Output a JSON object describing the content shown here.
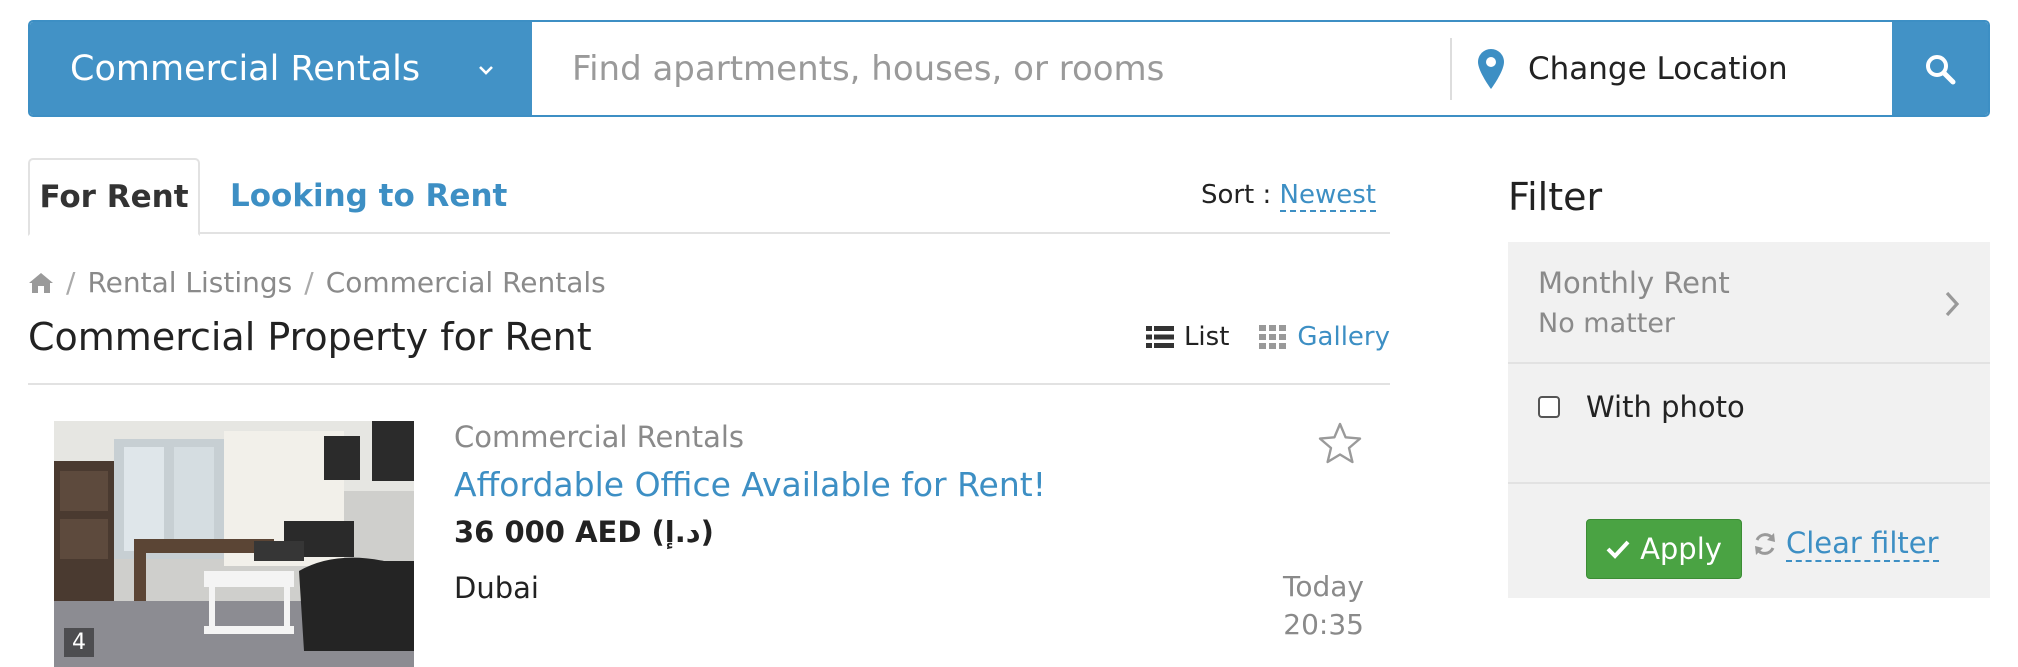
{
  "search": {
    "category": "Commercial Rentals",
    "placeholder": "Find apartments, houses, or rooms",
    "value": "",
    "location_label": "Change Location"
  },
  "tabs": [
    {
      "label": "For Rent",
      "active": true
    },
    {
      "label": "Looking to Rent",
      "active": false
    }
  ],
  "sort": {
    "label": "Sort :",
    "value": "Newest"
  },
  "breadcrumb": [
    "Rental Listings",
    "Commercial Rentals"
  ],
  "page_title": "Commercial Property for Rent",
  "view": {
    "list": "List",
    "gallery": "Gallery",
    "selected": "List"
  },
  "listing": {
    "category": "Commercial Rentals",
    "title": "Affordable Office Available for Rent!",
    "price": "36 000 AED (د.إ)",
    "city": "Dubai",
    "date_day": "Today",
    "date_time": "20:35",
    "photo_count": "4"
  },
  "filter": {
    "title": "Filter",
    "monthly_rent_label": "Monthly Rent",
    "monthly_rent_value": "No matter",
    "with_photo_label": "With photo",
    "with_photo_checked": false,
    "apply_label": "Apply",
    "clear_label": "Clear filter"
  },
  "colors": {
    "accent": "#4292c6",
    "link": "#3d8fc4",
    "apply": "#4aa343",
    "panel": "#f1f1f1"
  }
}
